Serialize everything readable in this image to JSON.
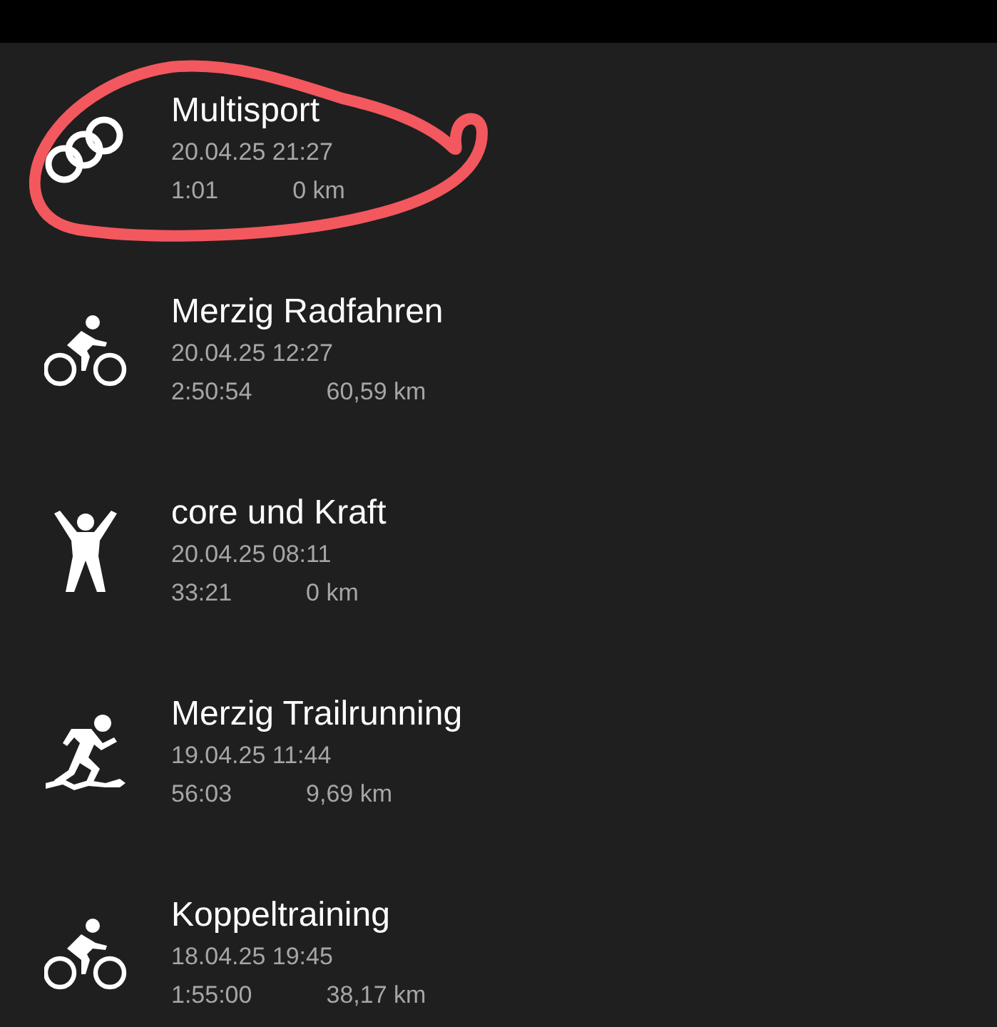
{
  "activities": [
    {
      "kind": "multisport",
      "title": "Multisport",
      "date": "20.04.25 21:27",
      "duration": "1:01",
      "distance": "0 km",
      "highlighted": true
    },
    {
      "kind": "cycling",
      "title": "Merzig Radfahren",
      "date": "20.04.25 12:27",
      "duration": "2:50:54",
      "distance": "60,59 km",
      "highlighted": false
    },
    {
      "kind": "strength",
      "title": "core und Kraft",
      "date": "20.04.25 08:11",
      "duration": "33:21",
      "distance": "0 km",
      "highlighted": false
    },
    {
      "kind": "trail_running",
      "title": "Merzig Trailrunning",
      "date": "19.04.25 11:44",
      "duration": "56:03",
      "distance": "9,69 km",
      "highlighted": false
    },
    {
      "kind": "cycling",
      "title": "Koppeltraining",
      "date": "18.04.25 19:45",
      "duration": "1:55:00",
      "distance": "38,17 km",
      "highlighted": false
    }
  ]
}
